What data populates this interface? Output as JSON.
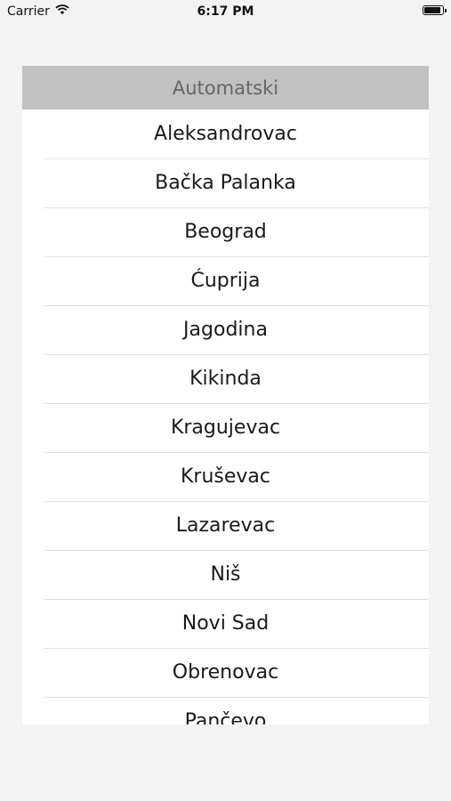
{
  "status_bar": {
    "carrier": "Carrier",
    "time": "6:17 PM",
    "battery_level": 0.9
  },
  "picker": {
    "header": "Automatski",
    "items": [
      "Aleksandrovac",
      "Bačka Palanka",
      "Beograd",
      "Ćuprija",
      "Jagodina",
      "Kikinda",
      "Kragujevac",
      "Kruševac",
      "Lazarevac",
      "Niš",
      "Novi Sad",
      "Obrenovac",
      "Pančevo"
    ]
  }
}
